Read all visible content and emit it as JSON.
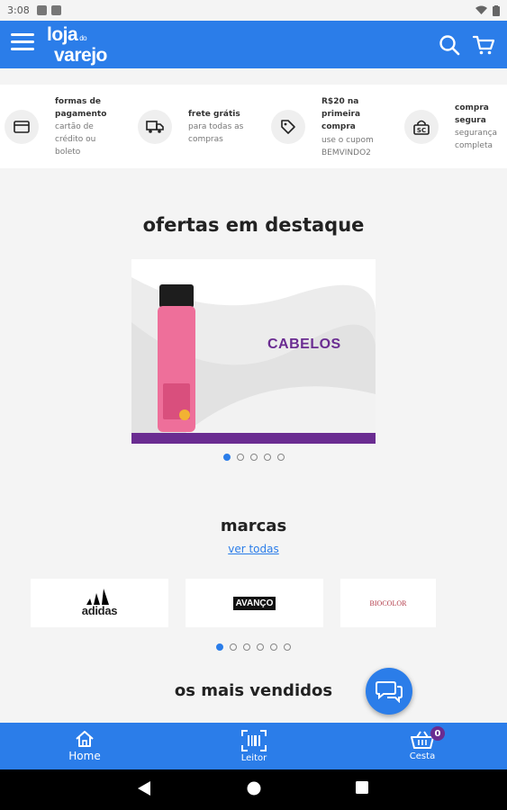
{
  "status_bar": {
    "time": "3:08"
  },
  "header": {
    "logo_line1": "loja",
    "logo_small": "do",
    "logo_line2": "varejo",
    "icons": [
      "menu-icon",
      "search-icon",
      "cart-icon"
    ]
  },
  "benefits": [
    {
      "icon": "credit-card-icon",
      "title": "formas de pagamento",
      "subtitle": "cartão de crédito ou boleto"
    },
    {
      "icon": "truck-icon",
      "title": "frete grátis",
      "subtitle": "para todas as compras"
    },
    {
      "icon": "tag-icon",
      "title": "R$20 na primeira compra",
      "subtitle": "use o cupom BEMVINDO2"
    },
    {
      "icon": "secure-lock-icon",
      "title": "compra segura",
      "subtitle": "segurança completa"
    }
  ],
  "featured": {
    "title": "ofertas em destaque",
    "banner_text": "CABELOS",
    "slide_count": 5,
    "active_slide": 1
  },
  "brands": {
    "title": "marcas",
    "see_all": "ver todas",
    "items": [
      "adidas",
      "AVANÇO",
      "BIOCOLOR"
    ],
    "slide_count": 6,
    "active_slide": 1
  },
  "best_sellers": {
    "title": "os mais vendidos"
  },
  "bottom_nav": {
    "home": "Home",
    "reader": "Leitor",
    "cart": "Cesta",
    "cart_count": "0"
  },
  "colors": {
    "primary": "#2b7de9",
    "accent_purple": "#6a2c91",
    "background": "#f4f4f4"
  }
}
